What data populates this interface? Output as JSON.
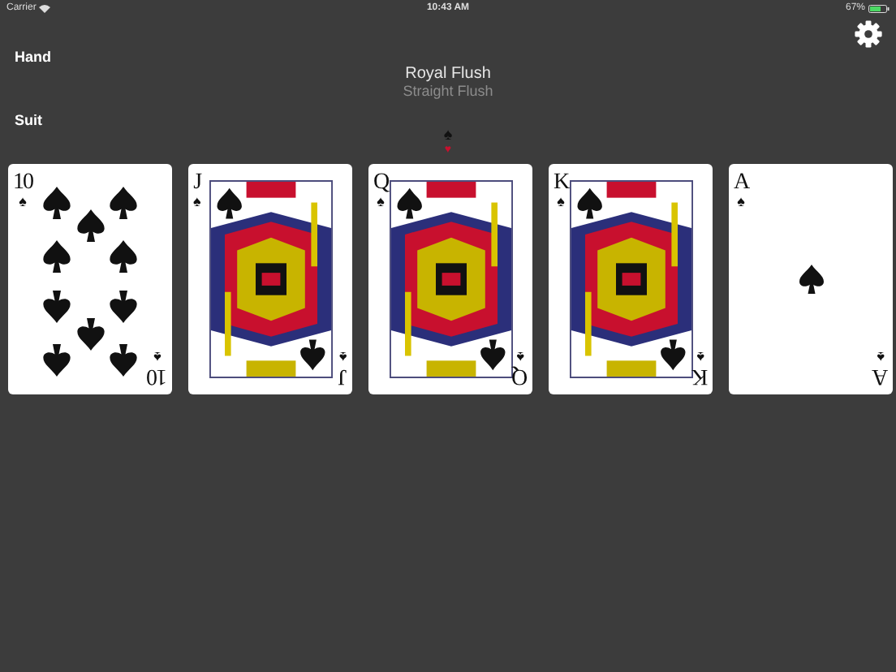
{
  "status_bar": {
    "carrier": "Carrier",
    "time": "10:43 AM",
    "battery": "67%"
  },
  "hand": {
    "label": "Hand",
    "options": [
      {
        "label": "Royal Flush",
        "selected": true
      },
      {
        "label": "Straight Flush",
        "selected": false
      }
    ]
  },
  "suit": {
    "label": "Suit",
    "options": [
      {
        "symbol": "♠",
        "color": "#111111",
        "selected": true
      },
      {
        "symbol": "♥",
        "color": "#c8102e",
        "selected": false
      }
    ]
  },
  "cards": [
    {
      "kind": "ten",
      "corners": [
        {
          "rank": "10",
          "suit": "♠"
        },
        {
          "rank": "10",
          "suit": "♠"
        }
      ]
    },
    {
      "kind": "face",
      "corners": [
        {
          "rank": "J",
          "suit": "♠"
        },
        {
          "rank": "J",
          "suit": "♠"
        }
      ]
    },
    {
      "kind": "face",
      "corners": [
        {
          "rank": "Q",
          "suit": "♠"
        },
        {
          "rank": "Q",
          "suit": "♠"
        }
      ]
    },
    {
      "kind": "face",
      "corners": [
        {
          "rank": "K",
          "suit": "♠"
        },
        {
          "rank": "K",
          "suit": "♠"
        }
      ]
    },
    {
      "kind": "ace",
      "corners": [
        {
          "rank": "A",
          "suit": "♠"
        },
        {
          "rank": "A",
          "suit": "♠"
        }
      ]
    }
  ]
}
